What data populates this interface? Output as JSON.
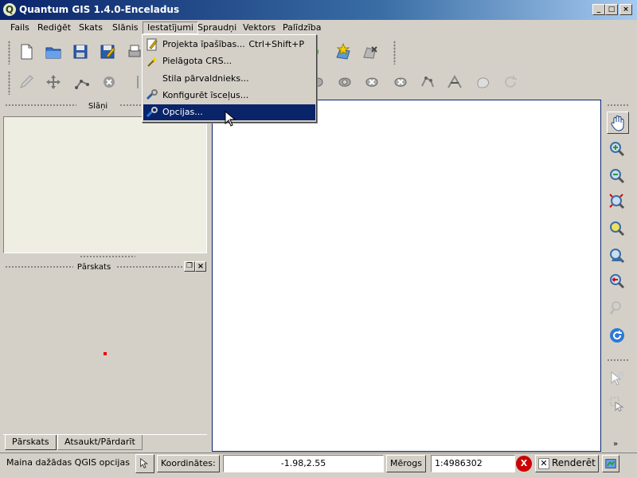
{
  "window": {
    "title": "Quantum GIS 1.4.0-Enceladus",
    "icon_letter": "Q",
    "controls": [
      "_",
      "□",
      "×"
    ]
  },
  "menubar": {
    "items": [
      "Fails",
      "Rediģēt",
      "Skats",
      "Slānis",
      "Iestatījumi",
      "Spraudņi",
      "Vektors",
      "Palīdzība"
    ],
    "active_index": 4
  },
  "settings_menu": {
    "items": [
      {
        "label": "Projekta īpašības...",
        "shortcut": "Ctrl+Shift+P",
        "icon": "project-properties-icon"
      },
      {
        "label": "Pielāgota CRS...",
        "shortcut": "",
        "icon": "custom-crs-icon"
      },
      {
        "label": "Stila pārvaldnieks...",
        "shortcut": "",
        "icon": ""
      },
      {
        "label": "Konfigurēt īsceļus...",
        "shortcut": "",
        "icon": "shortcuts-icon"
      },
      {
        "label": "Opcijas...",
        "shortcut": "",
        "icon": "options-wrench-icon",
        "highlighted": true
      }
    ]
  },
  "panels": {
    "layers_title": "Slāņi",
    "overview_title": "Pārskats",
    "tabs": [
      "Pārskats",
      "Atsaukt/Pārdarīt"
    ]
  },
  "statusbar": {
    "message": "Maina dažādas QGIS opcijas",
    "coord_label": "Koordinātes:",
    "coord_value": "-1.98,2.55",
    "scale_label": "Mērogs",
    "scale_value": "1:4986302",
    "render_label": "Renderēt",
    "render_checked": true
  },
  "colors": {
    "titlebar_start": "#0a246a",
    "highlight": "#0a246a",
    "chrome": "#d4d0c8",
    "layers_bg": "#eeeee2",
    "overview_dot": "#e00000"
  }
}
